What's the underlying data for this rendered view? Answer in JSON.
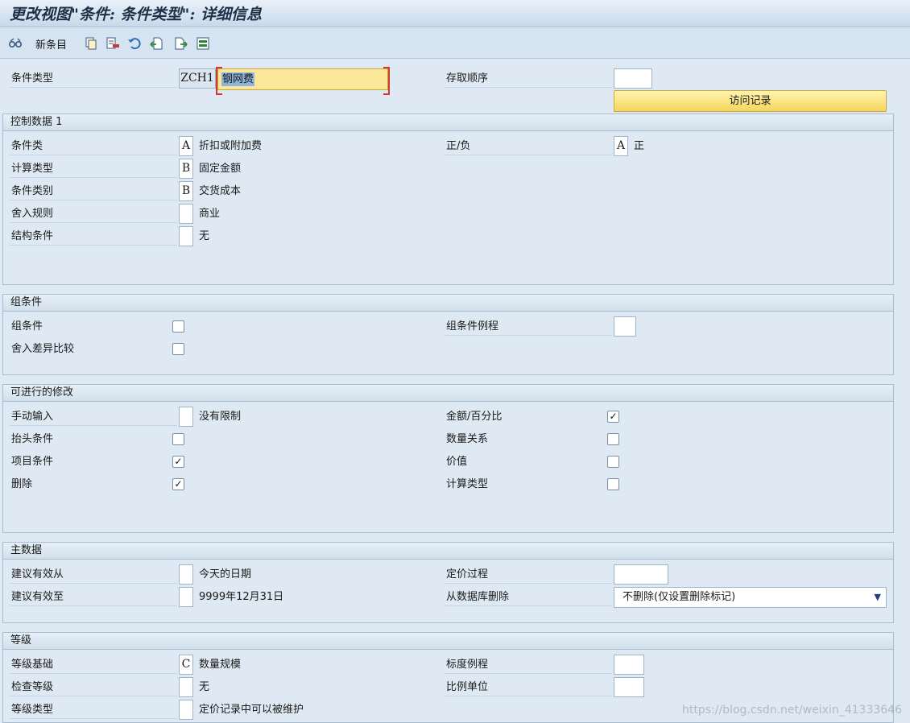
{
  "window": {
    "title": "更改视图\"条件: 条件类型\": 详细信息"
  },
  "toolbar": {
    "new_entries_label": "新条目",
    "icons": [
      "glasses-icon",
      "copy-icon",
      "delete-icon",
      "undo-icon",
      "previous-entry-icon",
      "next-entry-icon",
      "select-all-icon"
    ]
  },
  "header": {
    "condition_type_label": "条件类型",
    "condition_type_code": "ZCH1",
    "condition_type_name": "钢网费",
    "access_sequence_label": "存取顺序",
    "access_sequence_value": "",
    "records_button": "访问记录"
  },
  "control_data_1": {
    "title": "控制数据 1",
    "cond_class": {
      "label": "条件类",
      "value": "A",
      "desc": "折扣或附加费"
    },
    "plus_minus": {
      "label": "正/负",
      "value": "A",
      "desc": "正"
    },
    "calc_type": {
      "label": "计算类型",
      "value": "B",
      "desc": "固定金额"
    },
    "cond_category": {
      "label": "条件类别",
      "value": "B",
      "desc": "交货成本"
    },
    "rounding_rule": {
      "label": "舍入规则",
      "value": "",
      "desc": "商业"
    },
    "struct_cond": {
      "label": "结构条件",
      "value": "",
      "desc": "无"
    }
  },
  "group_condition": {
    "title": "组条件",
    "group_cond": {
      "label": "组条件",
      "checked": false
    },
    "group_cond_routine": {
      "label": "组条件例程",
      "value": ""
    },
    "rounding_diff": {
      "label": "舍入差异比较",
      "checked": false
    }
  },
  "changes": {
    "title": "可进行的修改",
    "manual_entry": {
      "label": "手动输入",
      "value": "",
      "desc": "没有限制"
    },
    "amount_percent": {
      "label": "金额/百分比",
      "checked": true
    },
    "header_cond": {
      "label": "抬头条件",
      "checked": false
    },
    "qty_relation": {
      "label": "数量关系",
      "checked": false
    },
    "item_cond": {
      "label": "项目条件",
      "checked": true
    },
    "value": {
      "label": "价值",
      "checked": false
    },
    "delete": {
      "label": "删除",
      "checked": true
    },
    "calc_type": {
      "label": "计算类型",
      "checked": false
    }
  },
  "master_data": {
    "title": "主数据",
    "valid_from": {
      "label": "建议有效从",
      "value": "",
      "desc": "今天的日期"
    },
    "pricing_proc": {
      "label": "定价过程",
      "value": ""
    },
    "valid_to": {
      "label": "建议有效至",
      "value": "",
      "desc": "9999年12月31日"
    },
    "delete_from_db": {
      "label": "从数据库删除",
      "selected": "不删除(仅设置删除标记)"
    }
  },
  "scales": {
    "title": "等级",
    "scale_basis": {
      "label": "等级基础",
      "value": "C",
      "desc": "数量规模"
    },
    "scale_formula": {
      "label": "标度例程",
      "value": ""
    },
    "check_scale": {
      "label": "检查等级",
      "value": "",
      "desc": "无"
    },
    "unit_of_meas": {
      "label": "比例单位",
      "value": ""
    },
    "scale_type": {
      "label": "等级类型",
      "value": "",
      "desc": "定价记录中可以被维护"
    }
  },
  "watermark": "https://blog.csdn.net/weixin_41333646",
  "colors": {
    "accent_yellow": "#fbe79a",
    "background": "#dfe9f3",
    "header_text": "#1e2f48"
  }
}
